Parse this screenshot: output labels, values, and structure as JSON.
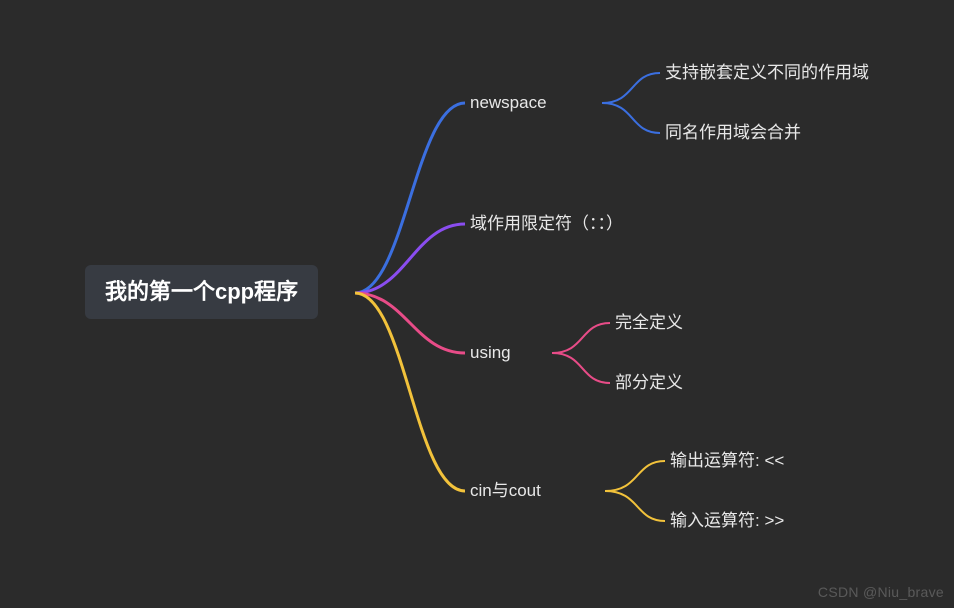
{
  "root": {
    "label": "我的第一个cpp程序"
  },
  "branches": [
    {
      "label": "newspace",
      "color": "#3b6fe0",
      "children": [
        {
          "label": "支持嵌套定义不同的作用域"
        },
        {
          "label": "同名作用域会合并"
        }
      ]
    },
    {
      "label": "域作用限定符（：：）",
      "color": "#8a4df0",
      "children": []
    },
    {
      "label": "using",
      "color": "#e84c88",
      "children": [
        {
          "label": "完全定义"
        },
        {
          "label": "部分定义"
        }
      ]
    },
    {
      "label": "cin与cout",
      "color": "#f2c23b",
      "children": [
        {
          "label": "输出运算符: <<"
        },
        {
          "label": "输入运算符: >>"
        }
      ]
    }
  ],
  "watermark": "CSDN @Niu_brave",
  "chart_data": {
    "type": "mindmap",
    "title": "我的第一个cpp程序",
    "root": "我的第一个cpp程序",
    "nodes": [
      {
        "label": "newspace",
        "children": [
          "支持嵌套定义不同的作用域",
          "同名作用域会合并"
        ]
      },
      {
        "label": "域作用限定符（：：）",
        "children": []
      },
      {
        "label": "using",
        "children": [
          "完全定义",
          "部分定义"
        ]
      },
      {
        "label": "cin与cout",
        "children": [
          "输出运算符: <<",
          "输入运算符: >>"
        ]
      }
    ]
  }
}
